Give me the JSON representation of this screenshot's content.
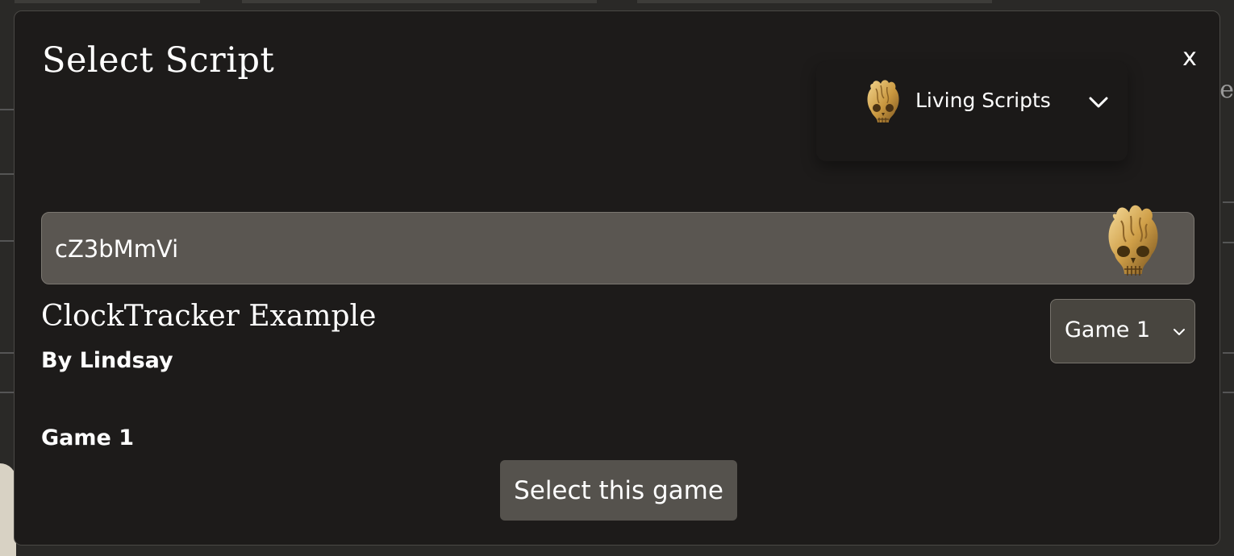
{
  "modal": {
    "title": "Select Script",
    "close_label": "x"
  },
  "source_dropdown": {
    "icon": "skull-heart-icon",
    "label": "Living Scripts",
    "chevron": "chevron-down-icon"
  },
  "script_code": {
    "value": "cZ3bMmVi",
    "icon": "skull-heart-icon"
  },
  "script": {
    "name": "ClockTracker Example",
    "author": "By Lindsay"
  },
  "game_dropdown": {
    "selected": "Game 1",
    "chevron": "chevron-down-icon"
  },
  "game": {
    "heading": "Game 1"
  },
  "actions": {
    "select_label": "Select this game"
  },
  "background": {
    "partial_text": "Re"
  },
  "colors": {
    "modal_bg": "#1d1b1a",
    "input_bg": "#5a5651",
    "button_bg": "#55524d",
    "icon_gold": "#d4ad5c"
  }
}
